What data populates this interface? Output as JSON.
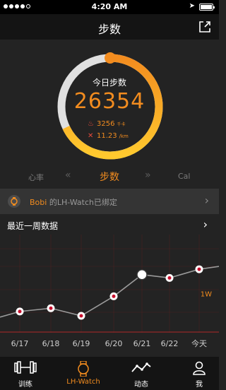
{
  "status": {
    "time": "4:20 AM"
  },
  "nav": {
    "title": "步数",
    "share_icon": "share-icon"
  },
  "ring": {
    "title": "今日步数",
    "value": "26354",
    "calories": "3256",
    "calories_unit": "千卡",
    "distance": "11.23",
    "distance_unit": "/km",
    "progress_fraction": 0.68,
    "colors": {
      "accent": "#f28c1f",
      "accent_light": "#ffc92e",
      "track": "#e0e0e0"
    }
  },
  "metric_tabs": {
    "left": "心率",
    "active": "步数",
    "right": "Cal"
  },
  "device": {
    "name": "Bobi",
    "suffix": " 的LH-Watch已绑定"
  },
  "week": {
    "title": "最近一周数据"
  },
  "chart_data": {
    "type": "line",
    "categories": [
      "6/17",
      "6/18",
      "6/19",
      "6/20",
      "6/21",
      "6/22",
      "今天"
    ],
    "values": [
      9500,
      11000,
      7500,
      16500,
      26500,
      25000,
      29000
    ],
    "highlight_index": 4,
    "goal_label": "1W",
    "goal_value": 10000,
    "ylim": [
      0,
      45000
    ]
  },
  "bottom_nav": {
    "items": [
      {
        "label": "训练",
        "icon": "dumbbell-icon"
      },
      {
        "label": "LH-Watch",
        "icon": "watch-icon",
        "active": true
      },
      {
        "label": "动态",
        "icon": "activity-icon"
      },
      {
        "label": "我",
        "icon": "person-icon"
      }
    ]
  }
}
